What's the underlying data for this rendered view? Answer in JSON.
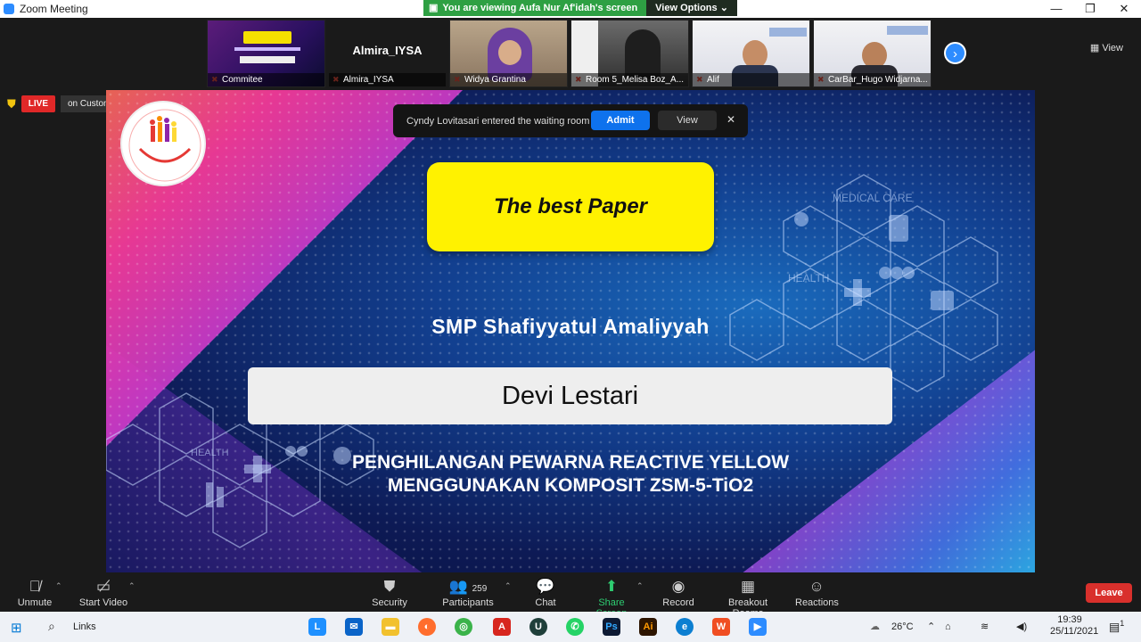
{
  "window": {
    "title": "Zoom Meeting",
    "controls": [
      "—",
      "❐",
      "✕"
    ]
  },
  "share_banner": {
    "message": "You are viewing Aufa Nur Af'idah's screen",
    "options_label": "View Options ⌄"
  },
  "view_button": "View",
  "thumbnails": [
    {
      "name": "Commitee",
      "big_label": ""
    },
    {
      "name": "Almira_IYSA",
      "big_label": "Almira_IYSA"
    },
    {
      "name": "Widya Grantina",
      "big_label": ""
    },
    {
      "name": "Room 5_Melisa Boz_A...",
      "big_label": ""
    },
    {
      "name": "Alif",
      "big_label": ""
    },
    {
      "name": "CarBar_Hugo Widjarna...",
      "big_label": ""
    }
  ],
  "live": {
    "badge": "LIVE",
    "service": "on Custom Live Streaming Service"
  },
  "waiting_room": {
    "message": "Cyndy Lovitasari entered the waiting room",
    "admit": "Admit",
    "view": "View",
    "close": "✕"
  },
  "slide": {
    "award": "The best Paper",
    "school": "SMP Shafiyyatul Amaliyyah",
    "name": "Devi Lestari",
    "title_line1": "PENGHILANGAN PEWARNA REACTIVE YELLOW",
    "title_line2": "MENGGUNAKAN KOMPOSIT ZSM-5-TiO2",
    "decor": {
      "medical_care": "MEDICAL CARE",
      "health": "HEALTH",
      "health2": "HEALTH"
    }
  },
  "toolbar": {
    "unmute": "Unmute",
    "start_video": "Start Video",
    "security": "Security",
    "participants": "Participants",
    "participants_count": "259",
    "chat": "Chat",
    "share_screen": "Share Screen",
    "record": "Record",
    "breakout_rooms": "Breakout Rooms",
    "reactions": "Reactions",
    "leave": "Leave"
  },
  "taskbar": {
    "search_label": "Links",
    "temperature": "26°C",
    "time": "19:39",
    "date": "25/11/2021",
    "notification_count": "1"
  },
  "colors": {
    "accent": "#2d8cff",
    "live_red": "#e02828",
    "share_green": "#2ea043",
    "award_yellow": "#fff200",
    "leave_red": "#d9302c"
  }
}
